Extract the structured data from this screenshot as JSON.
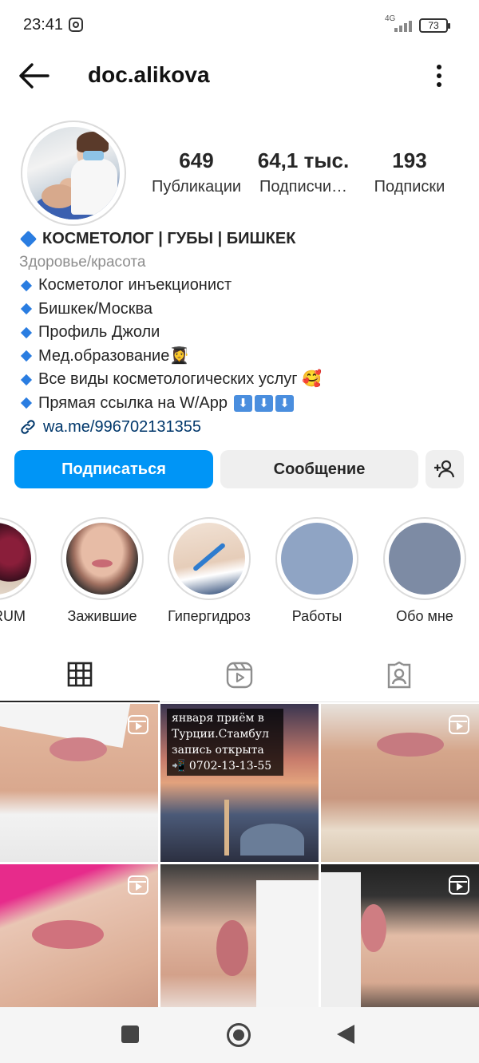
{
  "status_bar": {
    "time": "23:41",
    "network": "4G",
    "battery": "73"
  },
  "header": {
    "username": "doc.alikova",
    "back_icon": "arrow-left-icon",
    "more_icon": "more-vertical-icon"
  },
  "stats": [
    {
      "value": "649",
      "label": "Публикации"
    },
    {
      "value": "64,1 тыс.",
      "label": "Подписчи…"
    },
    {
      "value": "193",
      "label": "Подписки"
    }
  ],
  "bio": {
    "name": "КОСМЕТОЛОГ | ГУБЫ | БИШКЕК",
    "category": "Здоровье/красота",
    "lines": [
      "Косметолог инъекционист",
      "Бишкек/Москва",
      "Профиль Джоли",
      "Мед.образование👩‍🎓",
      "Все виды косметологических услуг 🥰",
      "Прямая ссылка на W/App"
    ],
    "link": "wa.me/996702131355"
  },
  "buttons": {
    "follow": "Подписаться",
    "message": "Сообщение",
    "add_user_icon": "add-person-icon"
  },
  "highlights": [
    {
      "label": "RUM"
    },
    {
      "label": "Зажившие"
    },
    {
      "label": "Гипергидроз"
    },
    {
      "label": "Работы"
    },
    {
      "label": "Обо мне"
    }
  ],
  "tabs": {
    "grid_icon": "grid-icon",
    "reels_icon": "reels-icon",
    "tagged_icon": "tagged-icon"
  },
  "posts": {
    "promo_text": "января приём в Турции.Стамбул запись открыта 📲 0702-13-13-55"
  },
  "colors": {
    "primary": "#0095f6",
    "text": "#262626",
    "muted": "#8e8e8e",
    "link": "#00376b"
  }
}
